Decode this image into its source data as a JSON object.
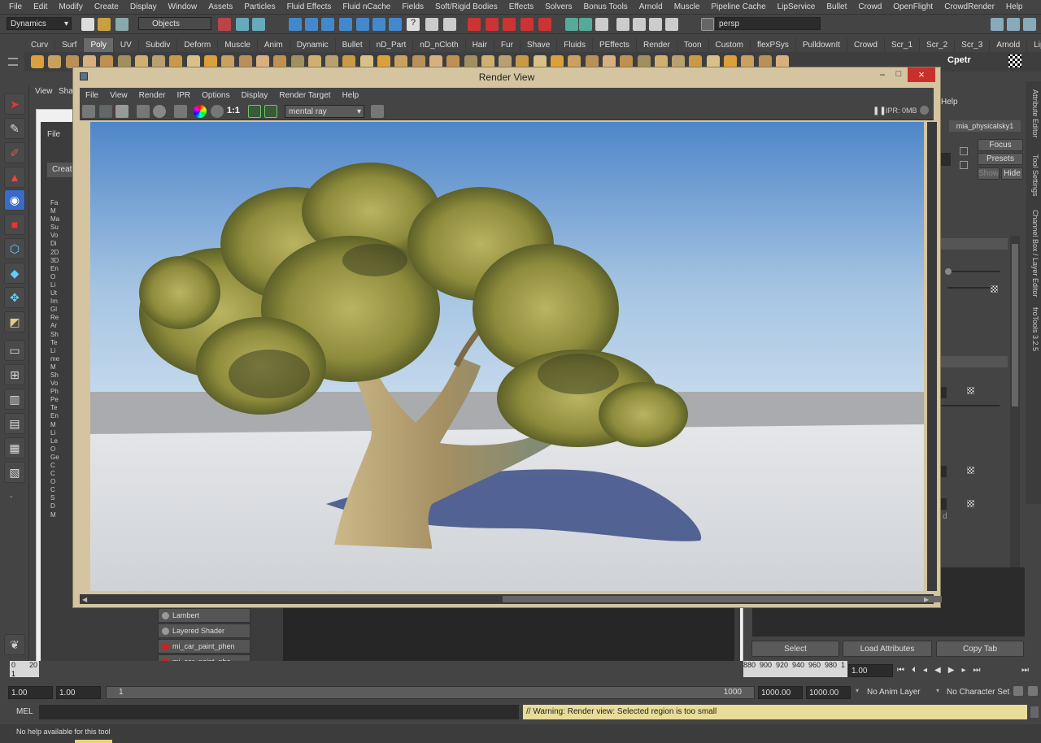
{
  "menubar": [
    "File",
    "Edit",
    "Modify",
    "Create",
    "Display",
    "Window",
    "Assets",
    "Particles",
    "Fluid Effects",
    "Fluid nCache",
    "Fields",
    "Soft/Rigid Bodies",
    "Effects",
    "Solvers",
    "Bonus Tools",
    "Arnold",
    "Muscle",
    "Pipeline Cache",
    "LipService",
    "Bullet",
    "Crowd",
    "OpenFlight",
    "CrowdRender",
    "Help"
  ],
  "status": {
    "menuset": "Dynamics",
    "selection_mode": "Objects",
    "camera_field": "persp"
  },
  "shelf_tabs": [
    "Curv",
    "Surf",
    "Poly",
    "UV",
    "Subdiv",
    "Deform",
    "Muscle",
    "Anim",
    "Dynamic",
    "Bullet",
    "nD_Part",
    "nD_nCloth",
    "Hair",
    "Fur",
    "Shave",
    "Fluids",
    "PEffects",
    "Render",
    "Toon",
    "Custom",
    "flexPSys",
    "PulldownIt",
    "Crowd",
    "Scr_1",
    "Scr_2",
    "Scr_3",
    "Arnold",
    "LipServ"
  ],
  "shelf_active": "Poly",
  "shelf_label_cpetr": "Cpetr",
  "back_panel": {
    "menu": [
      "View",
      "Sha"
    ],
    "hs_menu": [
      "File"
    ],
    "create": "Create",
    "tree": [
      "Fa",
      "M",
      "Ma",
      "Su",
      "Vo",
      "Di",
      "2D",
      "3D",
      "En",
      "O",
      "Li",
      "Ut",
      "Im",
      "Gl",
      "Re",
      "Ar",
      "Sh",
      "Te",
      "Li",
      "me",
      "M",
      "Sh",
      "Vo",
      "Ph",
      "Pe",
      "Te",
      "En",
      "M",
      "Li",
      "Le",
      "O",
      "Ge",
      "C",
      "C",
      "O",
      "C",
      "S",
      "D",
      "M"
    ]
  },
  "hypershade_shaders": [
    "Lambert",
    "Layered Shader",
    "mi_car_paint_phen",
    "mi_car_paint_phe"
  ],
  "render_view": {
    "title": "Render View",
    "menu": [
      "File",
      "View",
      "Render",
      "IPR",
      "Options",
      "Display",
      "Render Target",
      "Help"
    ],
    "ratio_label": "1:1",
    "renderer": "mental ray",
    "ipr_status": "IPR: 0MB"
  },
  "attr_editor": {
    "help": "Help",
    "node_tab": "mia_physicalsky1",
    "focus": "Focus",
    "presets": "Presets",
    "show": "Show",
    "hide": "Hide",
    "select": "Select",
    "load_attributes": "Load Attributes",
    "copy_tab": "Copy Tab",
    "partial_label": "d"
  },
  "vertical_tabs": [
    "Attribute Editor",
    "Tool Settings",
    "Channel Box / Layer Editor",
    "froTools 3.2.5"
  ],
  "timeline": {
    "ticks_left": [
      "0",
      "20"
    ],
    "tick_left_value": "1",
    "ticks_right": [
      "880",
      "900",
      "920",
      "940",
      "960",
      "980",
      "1"
    ],
    "current_frame": "1.00"
  },
  "range": {
    "start": "1.00",
    "start2": "1.00",
    "slider_start": "1",
    "slider_end": "1000",
    "end": "1000.00",
    "end2": "1000.00",
    "anim_layer": "No Anim Layer",
    "char_set": "No Character Set"
  },
  "mel_label": "MEL",
  "warning": "// Warning: Render view: Selected region is too small",
  "help_line": "No help available for this tool",
  "colors": {
    "warning_bg": "#e8dc98",
    "rv_frame": "#d4c4a0",
    "close_red": "#c9302c"
  }
}
